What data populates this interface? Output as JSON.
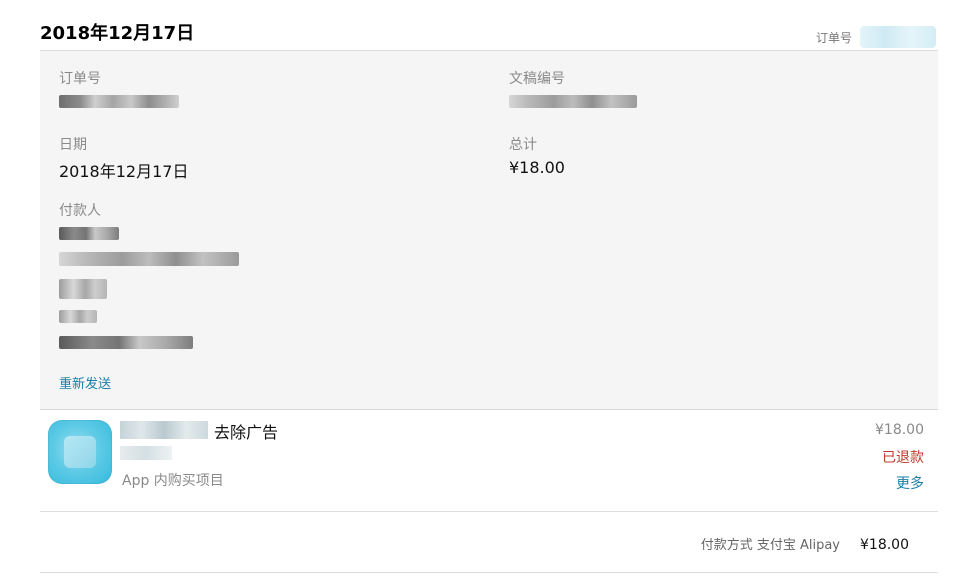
{
  "header": {
    "date": "2018年12月17日",
    "order_label": "订单号"
  },
  "summary": {
    "order_number_label": "订单号",
    "document_number_label": "文稿编号",
    "date_label": "日期",
    "date_value": "2018年12月17日",
    "total_label": "总计",
    "total_value": "¥18.00",
    "payer_label": "付款人",
    "resend_label": "重新发送"
  },
  "item": {
    "title": "去除广告",
    "kind": "App 内购买项目",
    "price": "¥18.00",
    "status": "已退款",
    "more_label": "更多"
  },
  "footer": {
    "payment_method": "付款方式 支付宝 Alipay",
    "total": "¥18.00"
  }
}
